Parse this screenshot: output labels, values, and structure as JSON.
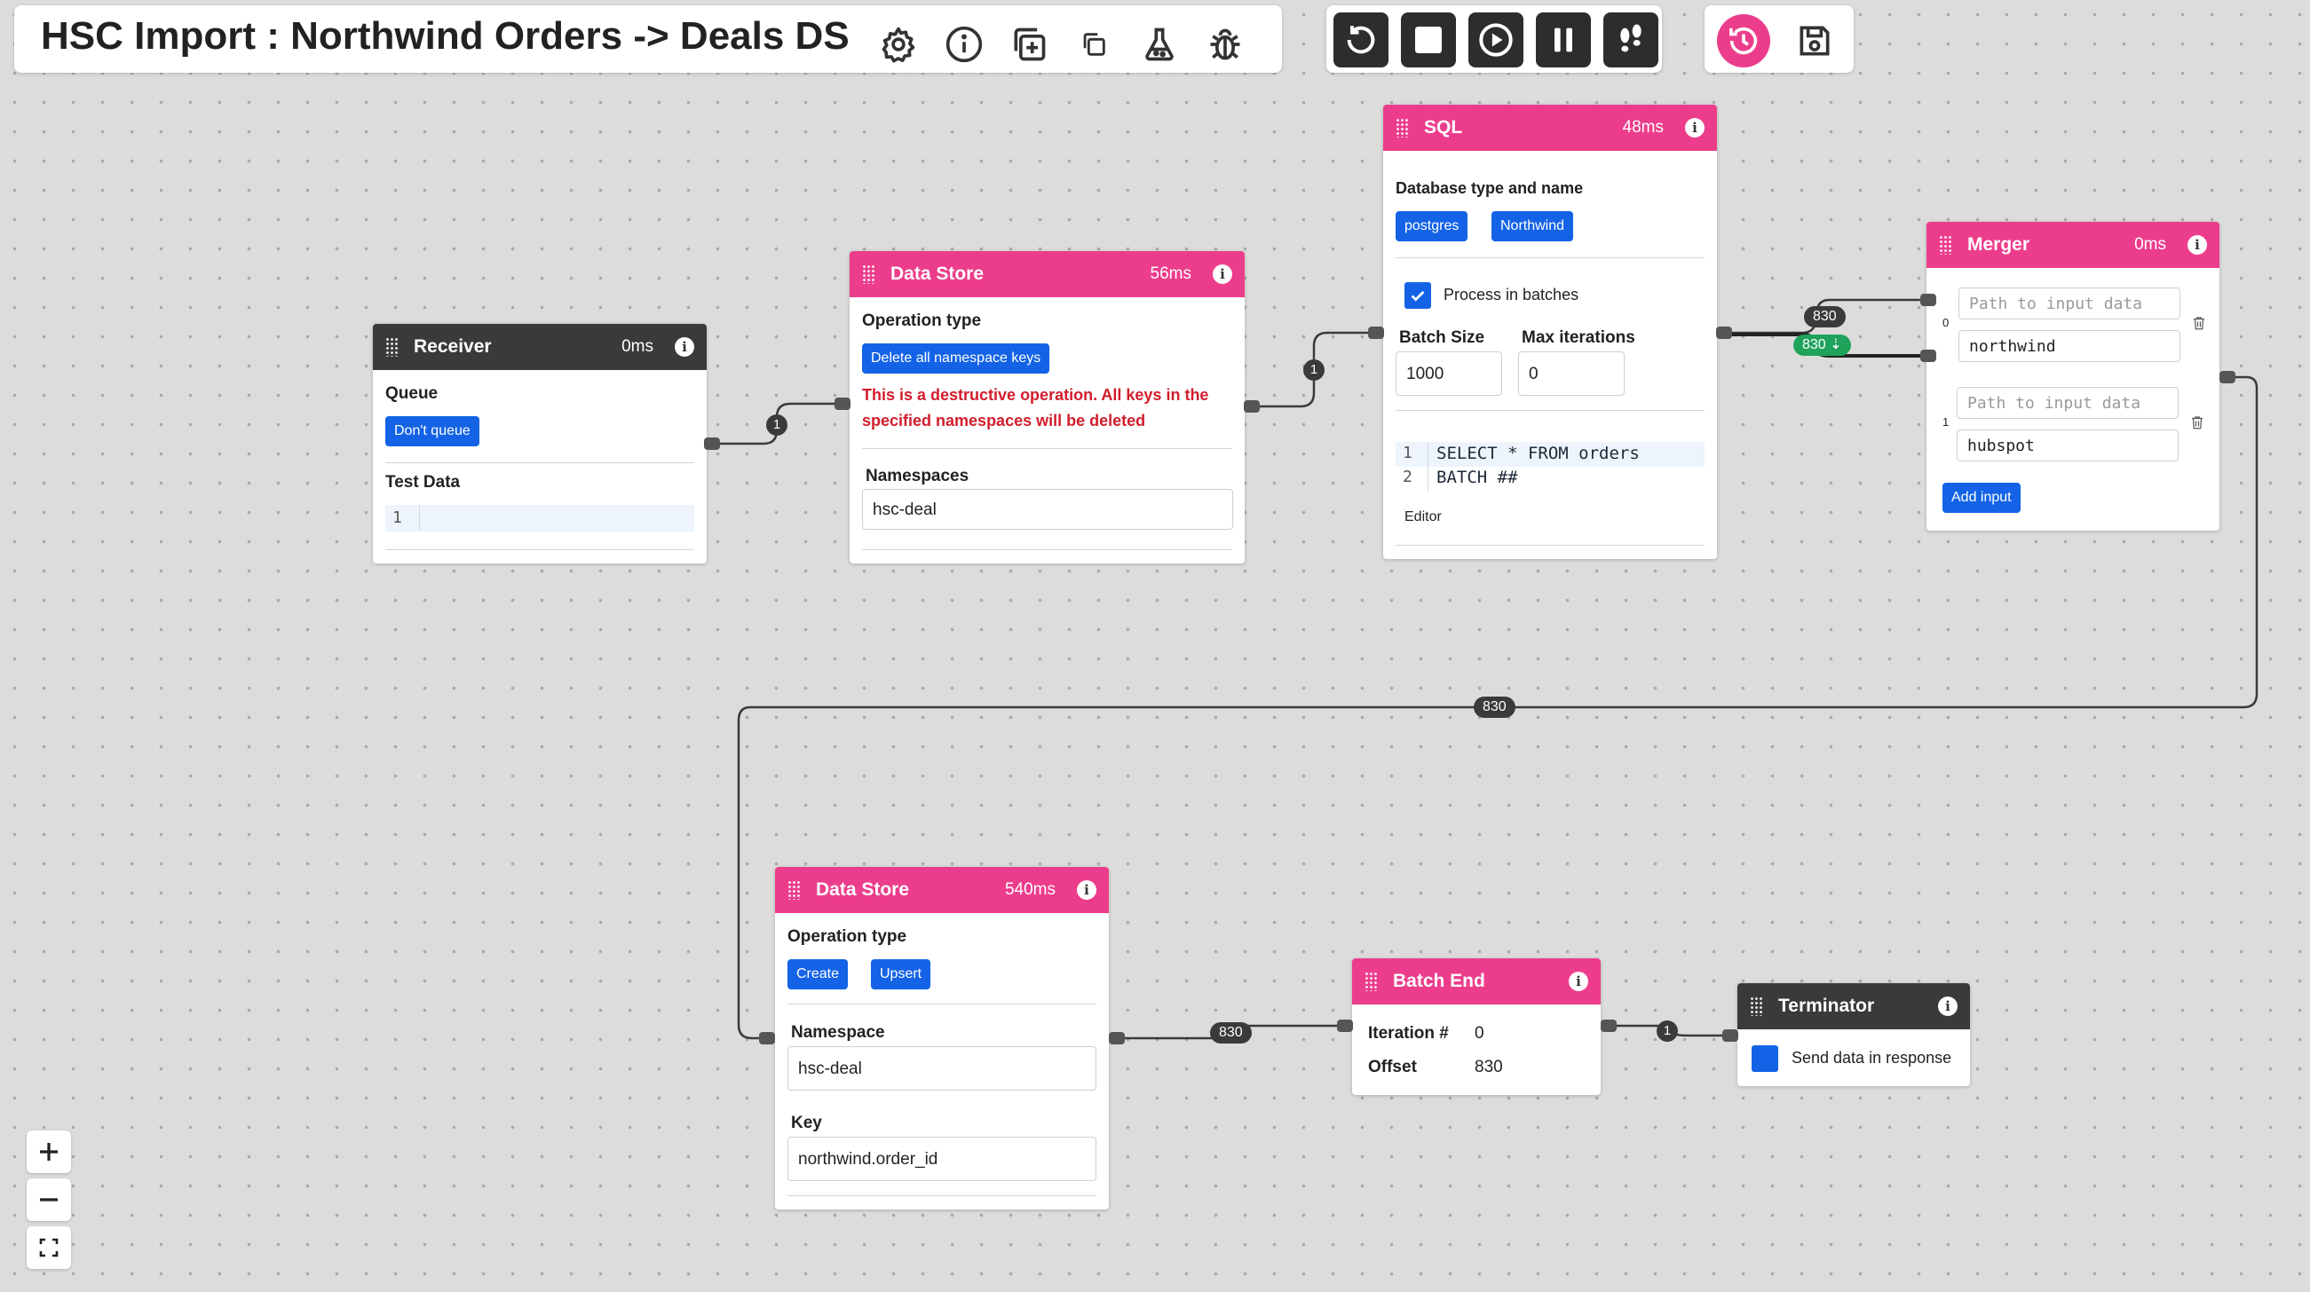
{
  "header": {
    "title": "HSC Import : Northwind Orders -> Deals DS",
    "icons": [
      "gear-icon",
      "info-icon",
      "duplicate-add-icon",
      "copy-icon",
      "flask-icon",
      "bug-icon"
    ]
  },
  "controls": {
    "buttons": [
      "restart-icon",
      "stop-icon",
      "play-icon",
      "pause-icon",
      "footsteps-icon"
    ],
    "right_buttons": [
      "history-icon",
      "save-icon"
    ],
    "accent": "#ec3d8c"
  },
  "nodes": {
    "receiver": {
      "title": "Receiver",
      "time": "0ms",
      "queue_label": "Queue",
      "queue_value": "Don't queue",
      "test_label": "Test Data",
      "test_line": "1"
    },
    "datastore1": {
      "title": "Data Store",
      "time": "56ms",
      "op_label": "Operation type",
      "op_value": "Delete all namespace keys",
      "warning": "This is a destructive operation. All keys in the specified namespaces will be deleted",
      "ns_label": "Namespaces",
      "ns_value": "hsc-deal"
    },
    "sql": {
      "title": "SQL",
      "time": "48ms",
      "db_label": "Database type and name",
      "db_type": "postgres",
      "db_name": "Northwind",
      "batch_checkbox_label": "Process in batches",
      "batch_checked": true,
      "batch_size_label": "Batch Size",
      "batch_size": "1000",
      "max_iter_label": "Max iterations",
      "max_iter": "0",
      "code": [
        {
          "n": "1",
          "text": "SELECT * FROM orders"
        },
        {
          "n": "2",
          "text": "BATCH ##"
        }
      ],
      "editor_label": "Editor"
    },
    "merger": {
      "title": "Merger",
      "time": "0ms",
      "inputs": [
        {
          "index": "0",
          "placeholder": "Path to input data",
          "name": "northwind"
        },
        {
          "index": "1",
          "placeholder": "Path to input data",
          "name": "hubspot"
        }
      ],
      "add_label": "Add input"
    },
    "datastore2": {
      "title": "Data Store",
      "time": "540ms",
      "op_label": "Operation type",
      "op_create": "Create",
      "op_upsert": "Upsert",
      "ns_label": "Namespace",
      "ns_value": "hsc-deal",
      "key_label": "Key",
      "key_value": "northwind.order_id"
    },
    "batchend": {
      "title": "Batch End",
      "iter_label": "Iteration #",
      "iter_value": "0",
      "offset_label": "Offset",
      "offset_value": "830"
    },
    "terminator": {
      "title": "Terminator",
      "send_label": "Send data in response"
    }
  },
  "edges": {
    "receiver_to_ds1": "1",
    "ds1_to_sql": "1",
    "sql_to_merger_top": "830",
    "sql_to_merger_bottom": "830",
    "merger_to_ds2": "830",
    "ds2_to_batchend": "830",
    "batchend_to_terminator": "1"
  },
  "zoom": [
    "zoom-in-icon",
    "zoom-out-icon",
    "fit-view-icon"
  ]
}
